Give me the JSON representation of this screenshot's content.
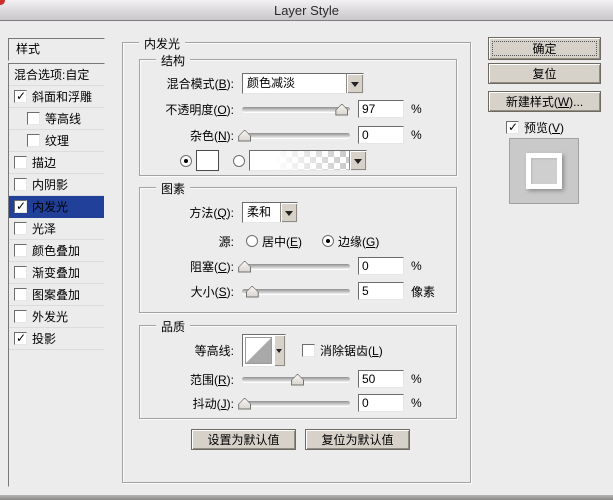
{
  "window": {
    "title": "Layer Style"
  },
  "colors": {
    "dialog_bg": "#ececec",
    "selection_blue": "#20409a",
    "button_face": "#d6d2ca",
    "titlebar_gradient_top": "#f2f0f2",
    "titlebar_gradient_bottom": "#c9c7c9"
  },
  "sidebar": {
    "header": "样式",
    "items": [
      {
        "name": "blending-options",
        "label": "混合选项:自定",
        "checkbox": false,
        "checked": false,
        "indent": false,
        "selected": false
      },
      {
        "name": "bevel-emboss",
        "label": "斜面和浮雕",
        "checkbox": true,
        "checked": true,
        "indent": false,
        "selected": false
      },
      {
        "name": "contour",
        "label": "等高线",
        "checkbox": true,
        "checked": false,
        "indent": true,
        "selected": false
      },
      {
        "name": "texture",
        "label": "纹理",
        "checkbox": true,
        "checked": false,
        "indent": true,
        "selected": false
      },
      {
        "name": "stroke",
        "label": "描边",
        "checkbox": true,
        "checked": false,
        "indent": false,
        "selected": false
      },
      {
        "name": "inner-shadow",
        "label": "内阴影",
        "checkbox": true,
        "checked": false,
        "indent": false,
        "selected": false
      },
      {
        "name": "inner-glow",
        "label": "内发光",
        "checkbox": true,
        "checked": true,
        "indent": false,
        "selected": true
      },
      {
        "name": "satin",
        "label": "光泽",
        "checkbox": true,
        "checked": false,
        "indent": false,
        "selected": false
      },
      {
        "name": "color-overlay",
        "label": "颜色叠加",
        "checkbox": true,
        "checked": false,
        "indent": false,
        "selected": false
      },
      {
        "name": "gradient-overlay",
        "label": "渐变叠加",
        "checkbox": true,
        "checked": false,
        "indent": false,
        "selected": false
      },
      {
        "name": "pattern-overlay",
        "label": "图案叠加",
        "checkbox": true,
        "checked": false,
        "indent": false,
        "selected": false
      },
      {
        "name": "outer-glow",
        "label": "外发光",
        "checkbox": true,
        "checked": false,
        "indent": false,
        "selected": false
      },
      {
        "name": "drop-shadow",
        "label": "投影",
        "checkbox": true,
        "checked": true,
        "indent": false,
        "selected": false
      }
    ]
  },
  "main": {
    "title": "内发光",
    "structure": {
      "legend": "结构",
      "blend_mode_label": "混合模式(B):",
      "blend_mode_value": "颜色减淡",
      "opacity_label": "不透明度(O):",
      "opacity_value": "97",
      "opacity_unit": "%",
      "noise_label": "杂色(N):",
      "noise_value": "0",
      "noise_unit": "%"
    },
    "elements": {
      "legend": "图素",
      "technique_label": "方法(Q):",
      "technique_value": "柔和",
      "source_label": "源:",
      "source_center_label": "居中(E)",
      "source_edge_label": "边缘(G)",
      "choke_label": "阻塞(C):",
      "choke_value": "0",
      "choke_unit": "%",
      "size_label": "大小(S):",
      "size_value": "5",
      "size_unit": "像素"
    },
    "quality": {
      "legend": "品质",
      "contour_label": "等高线:",
      "antialias_label": "消除锯齿(L)",
      "range_label": "范围(R):",
      "range_value": "50",
      "range_unit": "%",
      "jitter_label": "抖动(J):",
      "jitter_value": "0",
      "jitter_unit": "%"
    },
    "make_default_label": "设置为默认值",
    "reset_default_label": "复位为默认值"
  },
  "actions": {
    "ok": "确定",
    "reset": "复位",
    "new_style": "新建样式(W)...",
    "preview_label": "预览(V)"
  },
  "states": {
    "color_swatch_radio": true,
    "gradient_radio": false,
    "source_center": false,
    "source_edge": true,
    "antialias": false,
    "preview": true
  },
  "sliders": {
    "opacity": {
      "thumb_pct": 92
    },
    "noise": {
      "thumb_pct": 2
    },
    "choke": {
      "thumb_pct": 2
    },
    "size": {
      "thumb_pct": 9
    },
    "range": {
      "thumb_pct": 51
    },
    "jitter": {
      "thumb_pct": 2
    }
  }
}
